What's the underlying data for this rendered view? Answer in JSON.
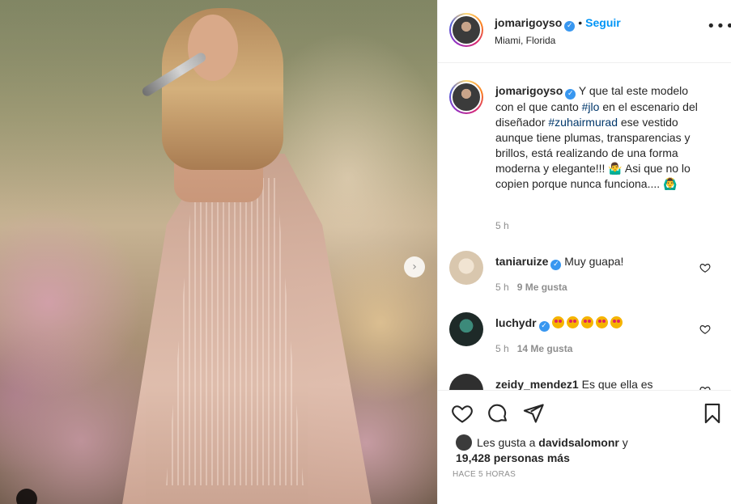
{
  "post": {
    "author": {
      "username": "jomarigoyso",
      "verified_icon": "check",
      "follow_label": "Seguir",
      "separator": "•",
      "location": "Miami, Florida"
    },
    "more_icon": "•••",
    "photo": {
      "next_icon": "›"
    },
    "caption": {
      "username": "jomarigoyso",
      "text_part1": "Y que tal este modelo con el que canto ",
      "hashtag1": "#jlo",
      "text_part2": " en el escenario del diseñador ",
      "hashtag2": "#zuhairmurad",
      "text_part3": " ese vestido aunque tiene plumas, transparencias y brillos, está realizando de una forma moderna y elegante!!! 🤷‍♂️ Asi que no lo copien porque nunca funciona.... 🙆‍♂️",
      "time": "5 h"
    },
    "comments": [
      {
        "username": "taniaruize",
        "verified": true,
        "text": "Muy guapa!",
        "time": "5 h",
        "likes": "9 Me gusta"
      },
      {
        "username": "luchydr",
        "verified": true,
        "emoji_count": 5,
        "time": "5 h",
        "likes": "14 Me gusta"
      },
      {
        "username": "zeidy_mendez1",
        "verified": false,
        "text": "Es que ella es"
      }
    ],
    "actions": {
      "liked_by_prefix": "Les gusta a ",
      "liked_by_user": "davidsalomonr",
      "liked_by_suffix": " y",
      "others_count": "19,428 personas más",
      "timestamp": "HACE 5 HORAS"
    },
    "colors": {
      "link_blue": "#0095f6",
      "verified_blue": "#3897f0",
      "hashtag": "#00376b",
      "muted": "#8e8e8e",
      "divider": "#efefef"
    }
  }
}
